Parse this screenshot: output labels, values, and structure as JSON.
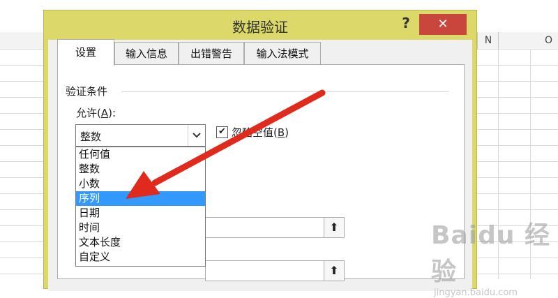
{
  "spreadsheet": {
    "columns": [
      "N",
      "O"
    ]
  },
  "dialog": {
    "title": "数据验证",
    "help_label": "?",
    "close_label": "✕",
    "tabs": [
      {
        "label": "设置",
        "active": true
      },
      {
        "label": "输入信息",
        "active": false
      },
      {
        "label": "出错警告",
        "active": false
      },
      {
        "label": "输入法模式",
        "active": false
      }
    ],
    "section_title": "验证条件",
    "allow": {
      "label_prefix": "允许(",
      "label_key": "A",
      "label_suffix": "):",
      "selected": "整数",
      "arrow_icon": "chevron-down-icon",
      "options": [
        "任何值",
        "整数",
        "小数",
        "序列",
        "日期",
        "时间",
        "文本长度",
        "自定义"
      ],
      "highlighted": "序列"
    },
    "ignore_blank": {
      "checked": true,
      "check_mark": "✔",
      "label_prefix": "忽略空值(",
      "label_key": "B",
      "label_suffix": ")"
    },
    "ref_button_icon": "range-collapse-icon",
    "ref_button_glyph": "⬆"
  },
  "annotation": {
    "arrow_color": "#e02a1e"
  },
  "watermark": {
    "main": "Baidu 经验",
    "sub": "jingyan.baidu.com"
  }
}
